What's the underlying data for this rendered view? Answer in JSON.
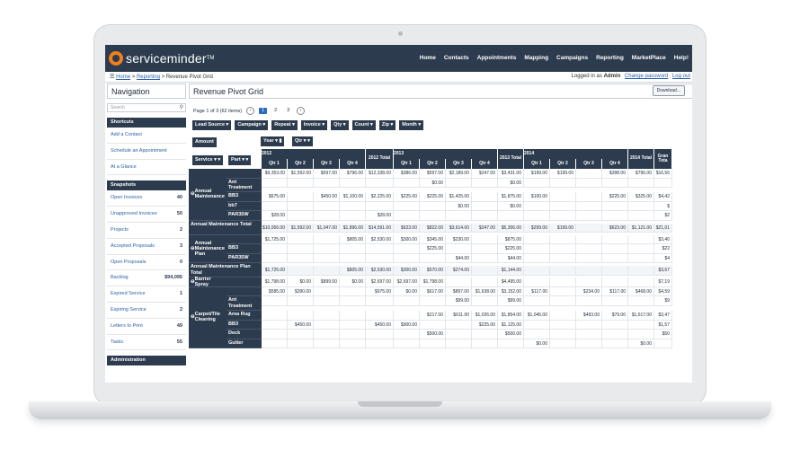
{
  "brand": {
    "name": "serviceminder",
    "tm": "TM"
  },
  "topnav": [
    "Home",
    "Contacts",
    "Appointments",
    "Mapping",
    "Campaigns",
    "Reporting",
    "MarketPlace",
    "Help!"
  ],
  "breadcrumb": {
    "home": "Home",
    "sep": ">",
    "reporting": "Reporting",
    "current": "Revenue Pivot Grid"
  },
  "login": {
    "text": "Logged in as",
    "user": "Admin",
    "change": "Change password",
    "logout": "Log out"
  },
  "sidebar": {
    "title": "Navigation",
    "search_placeholder": "Search",
    "shortcuts_label": "Shortcuts",
    "shortcuts": [
      "Add a Contact",
      "Schedule an Appointment",
      "At a Glance"
    ],
    "snapshots_label": "Snapshots",
    "snapshots": [
      {
        "label": "Open Invoices",
        "count": "40"
      },
      {
        "label": "Unapproved Invoices",
        "count": "50"
      },
      {
        "label": "Projects",
        "count": "2"
      },
      {
        "label": "Accepted Proposals",
        "count": "3"
      },
      {
        "label": "Open Proposals",
        "count": "0"
      },
      {
        "label": "Backlog",
        "count": "$94,095"
      },
      {
        "label": "Expired Service",
        "count": "1"
      },
      {
        "label": "Expiring Service",
        "count": "2"
      },
      {
        "label": "Letters to Print",
        "count": "49"
      },
      {
        "label": "Tasks",
        "count": "55"
      }
    ],
    "admin_label": "Administration"
  },
  "main": {
    "title": "Revenue Pivot Grid",
    "download": "Download...",
    "pager_text": "Page 1 of 3 (62 items)",
    "pages": [
      "1",
      "2",
      "3"
    ],
    "filter_fields": [
      "Lead Source",
      "Campaign",
      "Repeat",
      "Invoice",
      "Qty",
      "Count",
      "Zip",
      "Month"
    ],
    "data_field": "Amount",
    "col_fields": [
      "Year",
      "Qtr"
    ],
    "row_fields": [
      "Service",
      "Part"
    ]
  },
  "pivot": {
    "years": [
      "2012",
      "2012 Total",
      "2013",
      "2013 Total",
      "2014",
      "2014 Total",
      "Gran Tota"
    ],
    "quarters": [
      "Qtr 1",
      "Qtr 2",
      "Qtr 3",
      "Qtr 4"
    ],
    "groups": [
      {
        "service": "Annual Maintenance",
        "rows": [
          {
            "part": "",
            "v": [
              "$9,353.00",
              "$1,592.00",
              "$597.00",
              "$796.00",
              "$12,338.00",
              "$386.00",
              "$597.00",
              "$2,189.00",
              "$247.00",
              "$3,431.00",
              "$199.00",
              "$199.00",
              "",
              "$398.00",
              "$796.00",
              "$16,56"
            ]
          },
          {
            "part": "Ant Treatment",
            "v": [
              "",
              "",
              "",
              "",
              "",
              "",
              "$0.00",
              "",
              "",
              "$0.00",
              "",
              "",
              "",
              "",
              "",
              ""
            ]
          },
          {
            "part": "BB3",
            "v": [
              "$675.00",
              "",
              "$450.00",
              "$1,100.00",
              "$2,225.00",
              "$225.00",
              "$225.00",
              "$1,425.00",
              "",
              "$1,875.00",
              "$100.00",
              "",
              "",
              "$225.00",
              "$325.00",
              "$4,42"
            ]
          },
          {
            "part": "bb7",
            "v": [
              "",
              "",
              "",
              "",
              "",
              "",
              "",
              "$0.00",
              "",
              "$0.00",
              "",
              "",
              "",
              "",
              "",
              "$"
            ]
          },
          {
            "part": "PAR35W",
            "v": [
              "$28.00",
              "",
              "",
              "",
              "$28.00",
              "",
              "",
              "",
              "",
              "",
              "",
              "",
              "",
              "",
              "",
              "$2"
            ]
          }
        ],
        "total_label": "Annual Maintenance Total",
        "total": [
          "$10,056.00",
          "$1,592.00",
          "$1,047.00",
          "$1,896.00",
          "$14,591.00",
          "$623.00",
          "$822.00",
          "$3,614.00",
          "$247.00",
          "$5,306.00",
          "$299.00",
          "$199.00",
          "",
          "$623.00",
          "$1,121.00",
          "$21,01"
        ]
      },
      {
        "service": "Annual Maintenance Plan",
        "rows": [
          {
            "part": "",
            "v": [
              "$1,725.00",
              "",
              "",
              "$805.00",
              "$2,530.00",
              "$300.00",
              "$345.00",
              "$230.00",
              "",
              "$875.00",
              "",
              "",
              "",
              "",
              "",
              "$3,40"
            ]
          },
          {
            "part": "BB3",
            "v": [
              "",
              "",
              "",
              "",
              "",
              "",
              "$225.00",
              "",
              "",
              "$225.00",
              "",
              "",
              "",
              "",
              "",
              "$22"
            ]
          },
          {
            "part": "PAR35W",
            "v": [
              "",
              "",
              "",
              "",
              "",
              "",
              "",
              "$44.00",
              "",
              "$44.00",
              "",
              "",
              "",
              "",
              "",
              "$4"
            ]
          }
        ],
        "total_label": "Annual Maintenance Plan Total",
        "total": [
          "$1,725.00",
          "",
          "",
          "$805.00",
          "$2,530.00",
          "$300.00",
          "$570.00",
          "$274.00",
          "",
          "$1,144.00",
          "",
          "",
          "",
          "",
          "",
          "$3,67"
        ]
      },
      {
        "service": "Barrier Spray",
        "rows": [
          {
            "part": "",
            "v": [
              "$1,798.00",
              "$0.00",
              "$899.00",
              "$0.00",
              "$2,697.00",
              "$2,697.00",
              "$1,798.00",
              "",
              "",
              "$4,495.00",
              "",
              "",
              "",
              "",
              "",
              "$7,19"
            ]
          }
        ]
      },
      {
        "service": "Carpet/Tile Cleaning",
        "rows": [
          {
            "part": "",
            "v": [
              "$585.00",
              "$390.00",
              "",
              "",
              "$975.00",
              "$0.00",
              "$617.00",
              "$897.00",
              "$1,638.00",
              "$3,152.00",
              "$117.00",
              "",
              "$234.00",
              "$117.00",
              "$468.00",
              "$4,59"
            ]
          },
          {
            "part": "Ant Treatment",
            "v": [
              "",
              "",
              "",
              "",
              "",
              "",
              "",
              "$99.00",
              "",
              "$99.00",
              "",
              "",
              "",
              "",
              "",
              "$9"
            ]
          },
          {
            "part": "Area Rug",
            "v": [
              "",
              "",
              "",
              "",
              "",
              "",
              "$217.00",
              "$611.00",
              "$1,026.00",
              "$1,854.00",
              "$1,045.00",
              "",
              "$493.00",
              "$79.00",
              "$1,617.00",
              "$3,47"
            ]
          },
          {
            "part": "BB3",
            "v": [
              "",
              "$450.00",
              "",
              "",
              "$450.00",
              "$900.00",
              "",
              "",
              "$225.00",
              "$1,125.00",
              "",
              "",
              "",
              "",
              "",
              "$1,57"
            ]
          },
          {
            "part": "Deck",
            "v": [
              "",
              "",
              "",
              "",
              "",
              "",
              "$500.00",
              "",
              "",
              "$500.00",
              "",
              "",
              "",
              "",
              "",
              "$50"
            ]
          },
          {
            "part": "Gutter",
            "v": [
              "",
              "",
              "",
              "",
              "",
              "",
              "",
              "",
              "",
              "",
              "$0.00",
              "",
              "",
              "",
              "$0.00",
              ""
            ]
          }
        ]
      }
    ]
  }
}
